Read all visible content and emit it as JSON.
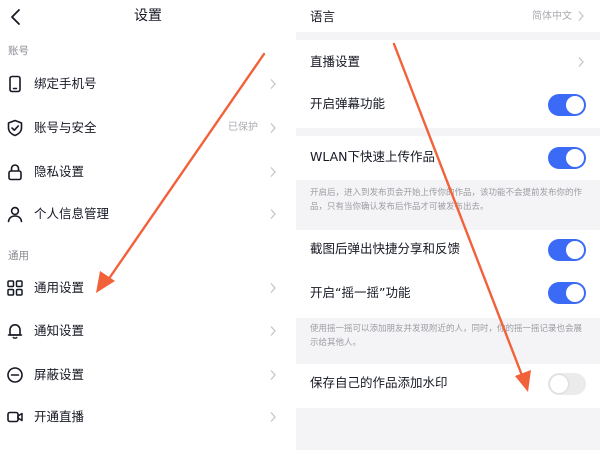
{
  "left": {
    "title": "设置",
    "sections": {
      "account": "账号",
      "general": "通用"
    },
    "items": [
      {
        "label": "绑定手机号"
      },
      {
        "label": "账号与安全",
        "status": "已保护"
      },
      {
        "label": "隐私设置"
      },
      {
        "label": "个人信息管理"
      },
      {
        "label": "通用设置"
      },
      {
        "label": "通知设置"
      },
      {
        "label": "屏蔽设置"
      },
      {
        "label": "开通直播"
      }
    ]
  },
  "right": {
    "language": {
      "label": "语言",
      "value": "简体中文"
    },
    "live": {
      "label": "直播设置"
    },
    "danmaku": {
      "label": "开启弹幕功能",
      "on": true
    },
    "wlan_upload": {
      "label": "WLAN下快速上传作品",
      "on": true
    },
    "wlan_hint": "开启后，进入到发布页会开始上传你的作品，该功能不会提前发布你的作品，只有当你确认发布后作品才可被发布出去。",
    "screenshot_share": {
      "label": "截图后弹出快捷分享和反馈",
      "on": true
    },
    "shake": {
      "label": "开启“摇一摇”功能",
      "on": true
    },
    "shake_hint": "使用摇一摇可以添加朋友并发现附近的人，同时，你的摇一摇记录也会展示给其他人。",
    "watermark": {
      "label": "保存自己的作品添加水印",
      "on": false
    }
  },
  "colors": {
    "accent": "#3b6bf6",
    "arrow": "#f2623a",
    "background_gray": "#f4f4f6"
  }
}
